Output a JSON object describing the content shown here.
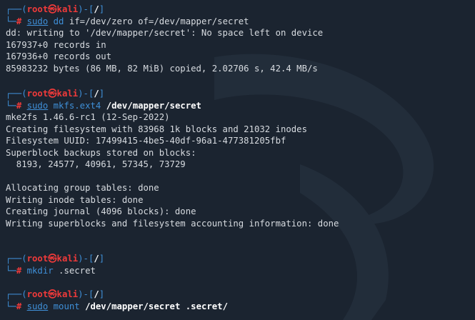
{
  "prompt": {
    "user": "root",
    "at": "㉿",
    "host": "kali",
    "path": "/",
    "hash": "#"
  },
  "blocks": [
    {
      "cmd_parts": [
        {
          "text": "sudo",
          "style": "blue-u"
        },
        {
          "text": " ",
          "style": "plain"
        },
        {
          "text": "dd",
          "style": "blue"
        },
        {
          "text": " if=/dev/zero of=/dev/mapper/secret",
          "style": "plain"
        }
      ],
      "output": [
        "dd: writing to '/dev/mapper/secret': No space left on device",
        "167937+0 records in",
        "167936+0 records out",
        "85983232 bytes (86 MB, 82 MiB) copied, 2.02706 s, 42.4 MB/s"
      ]
    },
    {
      "cmd_parts": [
        {
          "text": "sudo",
          "style": "blue-u"
        },
        {
          "text": " ",
          "style": "plain"
        },
        {
          "text": "mkfs.ext4",
          "style": "blue"
        },
        {
          "text": " ",
          "style": "plain"
        },
        {
          "text": "/dev/mapper/secret",
          "style": "bold"
        }
      ],
      "output": [
        "mke2fs 1.46.6-rc1 (12-Sep-2022)",
        "Creating filesystem with 83968 1k blocks and 21032 inodes",
        "Filesystem UUID: 17499415-4be5-40df-96a1-477381205fbf",
        "Superblock backups stored on blocks:",
        "  8193, 24577, 40961, 57345, 73729",
        "",
        "Allocating group tables: done",
        "Writing inode tables: done",
        "Creating journal (4096 blocks): done",
        "Writing superblocks and filesystem accounting information: done"
      ]
    },
    {
      "cmd_parts": [
        {
          "text": "mkdir",
          "style": "blue"
        },
        {
          "text": " .secret",
          "style": "plain"
        }
      ],
      "output": []
    },
    {
      "cmd_parts": [
        {
          "text": "sudo",
          "style": "blue-u"
        },
        {
          "text": " ",
          "style": "plain"
        },
        {
          "text": "mount",
          "style": "blue"
        },
        {
          "text": " ",
          "style": "plain"
        },
        {
          "text": "/dev/mapper/secret .secret/",
          "style": "bold"
        }
      ],
      "output": []
    }
  ]
}
